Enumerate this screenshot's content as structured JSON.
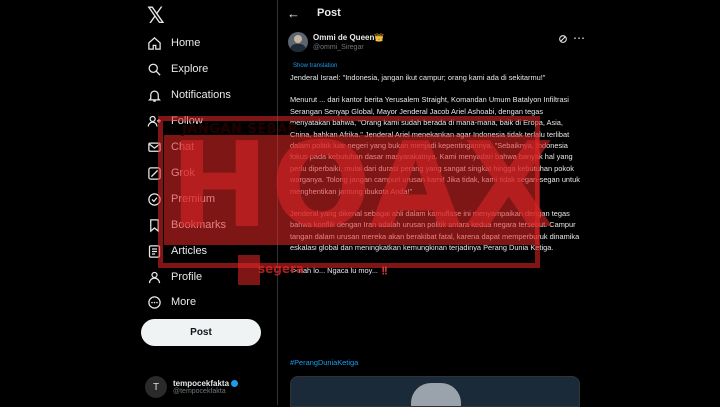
{
  "app": {
    "logo": "𝕏"
  },
  "sidebar": {
    "items": [
      {
        "label": "Home",
        "icon": "home-icon",
        "glyph": "⌂"
      },
      {
        "label": "Explore",
        "icon": "search-icon",
        "glyph": "⌕"
      },
      {
        "label": "Notifications",
        "icon": "bell-icon",
        "glyph": "🔔"
      },
      {
        "label": "Follow",
        "icon": "follow-icon",
        "glyph": "+"
      },
      {
        "label": "Chat",
        "icon": "chat-icon",
        "glyph": "✉"
      },
      {
        "label": "Grok",
        "icon": "grok-icon",
        "glyph": "◩"
      },
      {
        "label": "Premium",
        "icon": "premium-icon",
        "glyph": "✓"
      },
      {
        "label": "Bookmarks",
        "icon": "bookmark-icon",
        "glyph": "🔖"
      },
      {
        "label": "Articles",
        "icon": "articles-icon",
        "glyph": "▤"
      },
      {
        "label": "Profile",
        "icon": "profile-icon",
        "glyph": "👤"
      },
      {
        "label": "More",
        "icon": "more-icon",
        "glyph": "⋯"
      }
    ],
    "post_button": "Post",
    "account": {
      "name": "tempocekfakta",
      "handle": "@tempocekfakta",
      "avatar_text": "T"
    }
  },
  "main": {
    "header": {
      "title": "Post",
      "back_icon": "←"
    },
    "author": {
      "name": "Ommi de Queen👑",
      "handle": "@ommi_Siregar"
    },
    "show_translation": "Show translation",
    "paragraphs": [
      "Jenderal Israel: \"Indonesia, jangan ikut campur; orang kami ada di sekitarmu!\"",
      "Menurut ... dari kantor berita Yerusalem Straight, Komandan Umum Batalyon Infiltrasi Serangan Senyap Global, Mayor Jenderal Jacob Ariel Ashoabi, dengan tegas menyatakan bahwa, \"Orang kami sudah berada di mana-mana, baik di Eropa, Asia, China, bahkan Afrika.\" Jenderal Ariel menekankan agar Indonesia tidak terlalu terlibat dalam politik luar negeri yang bukan menjadi kepentingannya. \"Sebaiknya, Indonesia fokus pada kebutuhan dasar masyarakatnya. Kami menyadari bahwa banyak hal yang perlu diperbaiki, mulai dari durasi perang yang sangat singkat hingga kebutuhan pokok warganya. Tolong jangan campuri urusan kami! Jika tidak, kami tidak segan-segan untuk menghentikan jantung ibukota Anda!\"",
      "Jenderal yang dikenal sebagai ahli dalam kamuflase ini menyampaikan dengan tegas bahwa konflik dengan Iran adalah urusan politik antara kedua negara tersebut. Campur tangan dalam urusan mereka akan berakibat fatal, karena dapat memperburuk dinamika eskalasi global dan meningkatkan kemungkinan terjadinya Perang Dunia Ketiga.",
      "-> nah lo... Ngaca lu moy... ‼️"
    ],
    "hashtag": "#PerangDuniaKetiga"
  },
  "overlay": {
    "top_text": "JANGAN SEBAR",
    "stamp": "HOAX",
    "bottom_text": "segera",
    "color": "#e62828"
  }
}
